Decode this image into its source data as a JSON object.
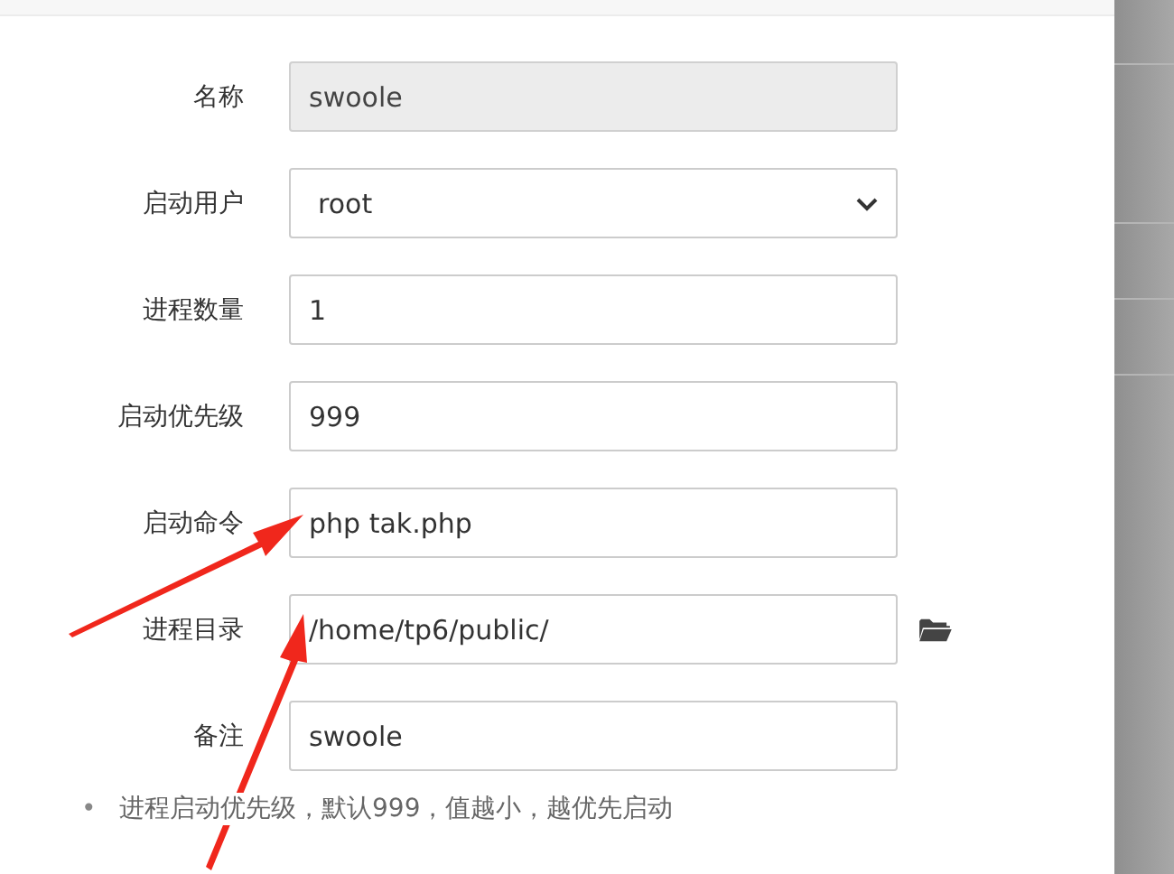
{
  "form": {
    "fields": [
      {
        "label": "名称",
        "kind": "text",
        "value": "swoole",
        "readonly": true
      },
      {
        "label": "启动用户",
        "kind": "select",
        "value": "root",
        "readonly": false
      },
      {
        "label": "进程数量",
        "kind": "text",
        "value": "1",
        "readonly": false
      },
      {
        "label": "启动优先级",
        "kind": "text",
        "value": "999",
        "readonly": false
      },
      {
        "label": "启动命令",
        "kind": "text",
        "value": "php tak.php",
        "readonly": false
      },
      {
        "label": "进程目录",
        "kind": "folder",
        "value": "/home/tp6/public/",
        "readonly": false
      },
      {
        "label": "备注",
        "kind": "text",
        "value": "swoole",
        "readonly": false
      }
    ],
    "notes": [
      {
        "bullet": "•",
        "text": "进程启动优先级，默认999，值越小，越优先启动"
      }
    ]
  }
}
